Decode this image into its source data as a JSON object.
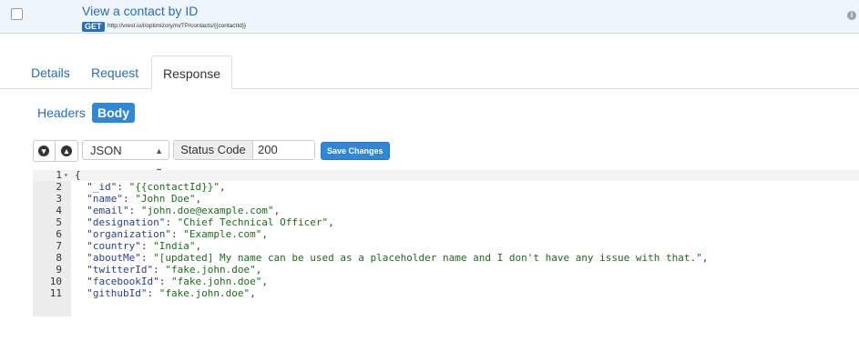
{
  "request": {
    "title": "View a contact by ID",
    "method": "GET",
    "url": "http://vrest.io/i/optimizory/m/TP/contacts/{{contactId}}",
    "info_icon": "info-icon"
  },
  "tabs": [
    "Details",
    "Request",
    "Response"
  ],
  "active_tab": "Response",
  "response_tabs": [
    "Headers",
    "Body"
  ],
  "active_response_tab": "Body",
  "toolbar": {
    "download_icon": "arrow-down-circle-icon",
    "upload_icon": "arrow-up-circle-icon",
    "format": "JSON",
    "status_label": "Status Code",
    "status_value": "200",
    "save_label": "Save Changes"
  },
  "editor": {
    "lines": [
      {
        "n": "1",
        "fold": "▾",
        "text": "{"
      },
      {
        "n": "2",
        "key": "_id",
        "value": "{{contactId}}"
      },
      {
        "n": "3",
        "key": "name",
        "value": "John Doe"
      },
      {
        "n": "4",
        "key": "email",
        "value": "john.doe@example.com"
      },
      {
        "n": "5",
        "key": "designation",
        "value": "Chief Technical Officer"
      },
      {
        "n": "6",
        "key": "organization",
        "value": "Example.com"
      },
      {
        "n": "7",
        "key": "country",
        "value": "India"
      },
      {
        "n": "8",
        "key": "aboutMe",
        "value": "[updated] My name can be used as a placeholder name and I don't have any issue with that."
      },
      {
        "n": "9",
        "key": "twitterId",
        "value": "fake.john.doe"
      },
      {
        "n": "10",
        "key": "facebookId",
        "value": "fake.john.doe"
      },
      {
        "n": "11",
        "key": "githubId",
        "value": "fake.john.doe"
      }
    ]
  }
}
